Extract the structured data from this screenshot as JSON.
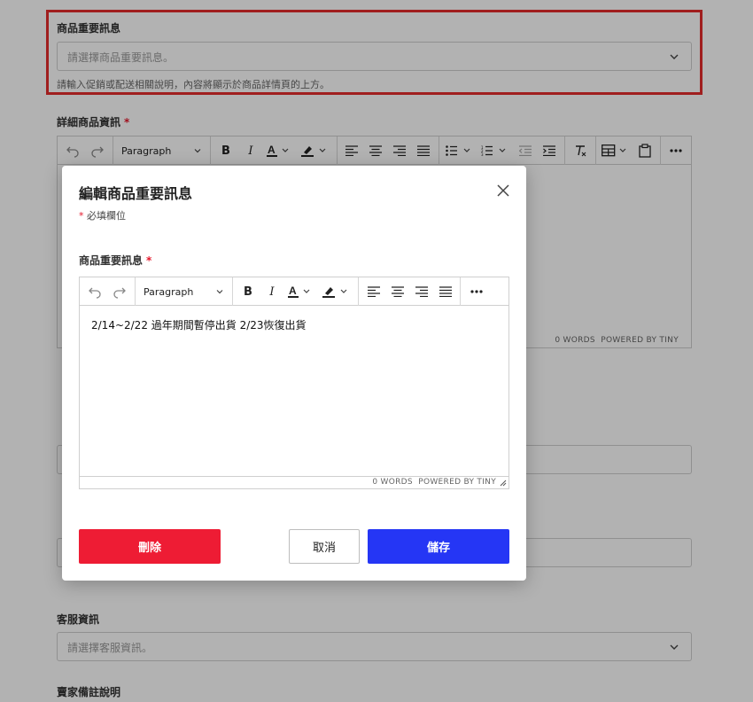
{
  "form": {
    "important_info": {
      "label": "商品重要訊息",
      "placeholder": "請選擇商品重要訊息。",
      "hint": "請輸入促銷或配送相關說明，內容將顯示於商品詳情頁的上方。"
    },
    "detail_info": {
      "label": "詳細商品資訊",
      "required_mark": "*",
      "toolbar_block": "Paragraph",
      "status_words": "0 WORDS",
      "status_powered": "POWERED BY TINY"
    },
    "customer_service": {
      "label": "客服資訊",
      "placeholder": "請選擇客服資訊。"
    },
    "seller_note": {
      "label": "賣家備註說明"
    }
  },
  "modal": {
    "title": "編輯商品重要訊息",
    "required_mark": "*",
    "required_note": "必填欄位",
    "field_label": "商品重要訊息",
    "editor": {
      "block_format": "Paragraph",
      "content": "2/14~2/22 過年期間暫停出貨 2/23恢復出貨",
      "status_words": "0 WORDS",
      "status_powered": "POWERED BY TINY"
    },
    "buttons": {
      "delete": "刪除",
      "cancel": "取消",
      "save": "儲存"
    }
  },
  "colors": {
    "highlight": "#e52b2b",
    "delete": "#ee1c34",
    "save": "#2536f5",
    "required": "#e5172b"
  }
}
